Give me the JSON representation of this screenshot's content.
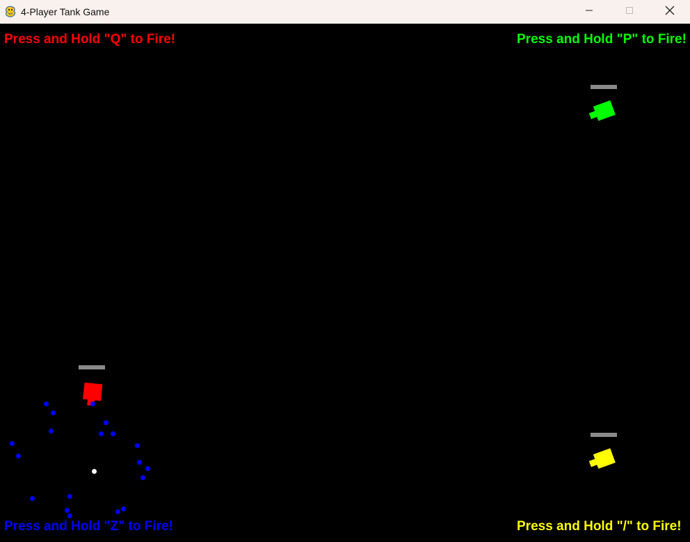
{
  "window": {
    "title": "4-Player Tank Game",
    "app_icon": "pygame-snake-icon",
    "controls": [
      "minimize-icon",
      "maximize-icon",
      "close-icon"
    ]
  },
  "players": [
    {
      "id": "red",
      "color": "#ff0000",
      "fire_hint": "Press and Hold \"Q\" to Fire!",
      "corner": "top-left"
    },
    {
      "id": "green",
      "color": "#00ff00",
      "fire_hint": "Press and Hold \"P\" to Fire!",
      "corner": "top-right"
    },
    {
      "id": "blue",
      "color": "#0000ff",
      "fire_hint": "Press and Hold \"Z\" to Fire!",
      "corner": "bottom-left"
    },
    {
      "id": "yellow",
      "color": "#ffff00",
      "fire_hint": "Press and Hold \"/\" to Fire!",
      "corner": "bottom-right"
    }
  ],
  "colors": {
    "background": "#000000",
    "health_bar": "#8a8a8a",
    "titlebar": "#f9f1ee",
    "blue_bullet": "#0000ff",
    "white_bullet": "#ffffff"
  }
}
